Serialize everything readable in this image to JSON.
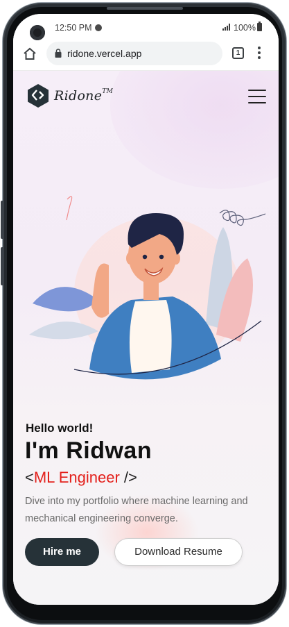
{
  "status_bar": {
    "time": "12:50 PM",
    "battery": "100%"
  },
  "browser": {
    "url": "ridone.vercel.app",
    "tab_count": "1"
  },
  "site": {
    "brand": "Ridone",
    "brand_tm": "TM"
  },
  "hero": {
    "greeting": "Hello world!",
    "name": "I'm Ridwan",
    "role_open": "<",
    "role": "ML Engineer",
    "role_close": " />",
    "tagline": "Dive into my portfolio where machine learning and mechanical engineering converge.",
    "primary_button": "Hire me",
    "secondary_button": "Download Resume"
  },
  "colors": {
    "accent": "#e3201b",
    "dark_button": "#263238",
    "jacket": "#3f7fc1",
    "hair": "#1f2545"
  },
  "icons": [
    "home-icon",
    "lock-icon",
    "tabs-icon",
    "more-vert-icon",
    "menu-icon",
    "spotify-icon",
    "signal-icon",
    "battery-icon"
  ]
}
